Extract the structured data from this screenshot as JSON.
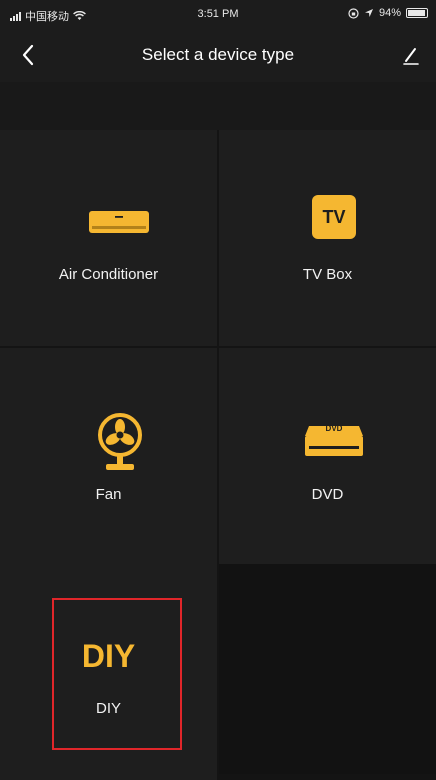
{
  "status_bar": {
    "carrier": "中国移动",
    "time": "3:51 PM",
    "battery_percent": "94%"
  },
  "nav": {
    "title": "Select a device type"
  },
  "devices": [
    {
      "label": "Air Conditioner",
      "icon": "air-conditioner-icon"
    },
    {
      "label": "TV Box",
      "icon": "tv-box-icon",
      "icon_text": "TV"
    },
    {
      "label": "Fan",
      "icon": "fan-icon"
    },
    {
      "label": "DVD",
      "icon": "dvd-icon",
      "icon_text": "DVD"
    },
    {
      "label": "DIY",
      "icon": "diy-icon",
      "icon_text": "DIY"
    }
  ],
  "colors": {
    "accent": "#F5B731",
    "background": "#141414",
    "cell": "#1E1E1E",
    "highlight": "#E0262A"
  }
}
